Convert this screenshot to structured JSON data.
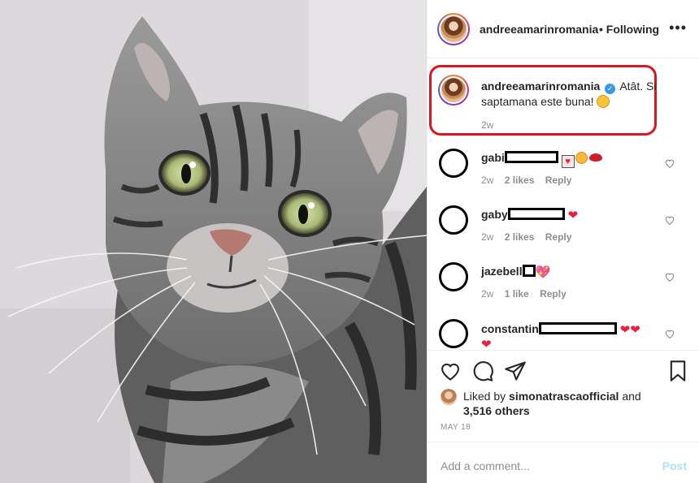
{
  "header": {
    "username": "andreeamarinromania",
    "follow_label": "• Following",
    "more_icon": "more-dots-icon"
  },
  "caption": {
    "username": "andreeamarinromania",
    "text": "Atât. Si saptamana este buna!",
    "time": "2w"
  },
  "comments": [
    {
      "user_prefix": "gabi",
      "time": "2w",
      "likes": "2 likes",
      "reply": "Reply"
    },
    {
      "user_prefix": "gaby",
      "time": "2w",
      "likes": "2 likes",
      "reply": "Reply"
    },
    {
      "user_prefix": "jazebell",
      "time": "2w",
      "likes": "1 like",
      "reply": "Reply"
    },
    {
      "user_prefix": "constantin"
    }
  ],
  "liked_by": {
    "prefix": "Liked by",
    "user": "simonatrascaofficial",
    "middle": "and",
    "others": "3,516 others"
  },
  "date": "MAY 18",
  "add_comment": {
    "placeholder": "Add a comment...",
    "post_label": "Post"
  },
  "colors": {
    "highlight_border": "#e0141e",
    "verified_blue": "#3897f0",
    "post_disabled": "#b2dffc",
    "muted_text": "#8e8e8e"
  }
}
